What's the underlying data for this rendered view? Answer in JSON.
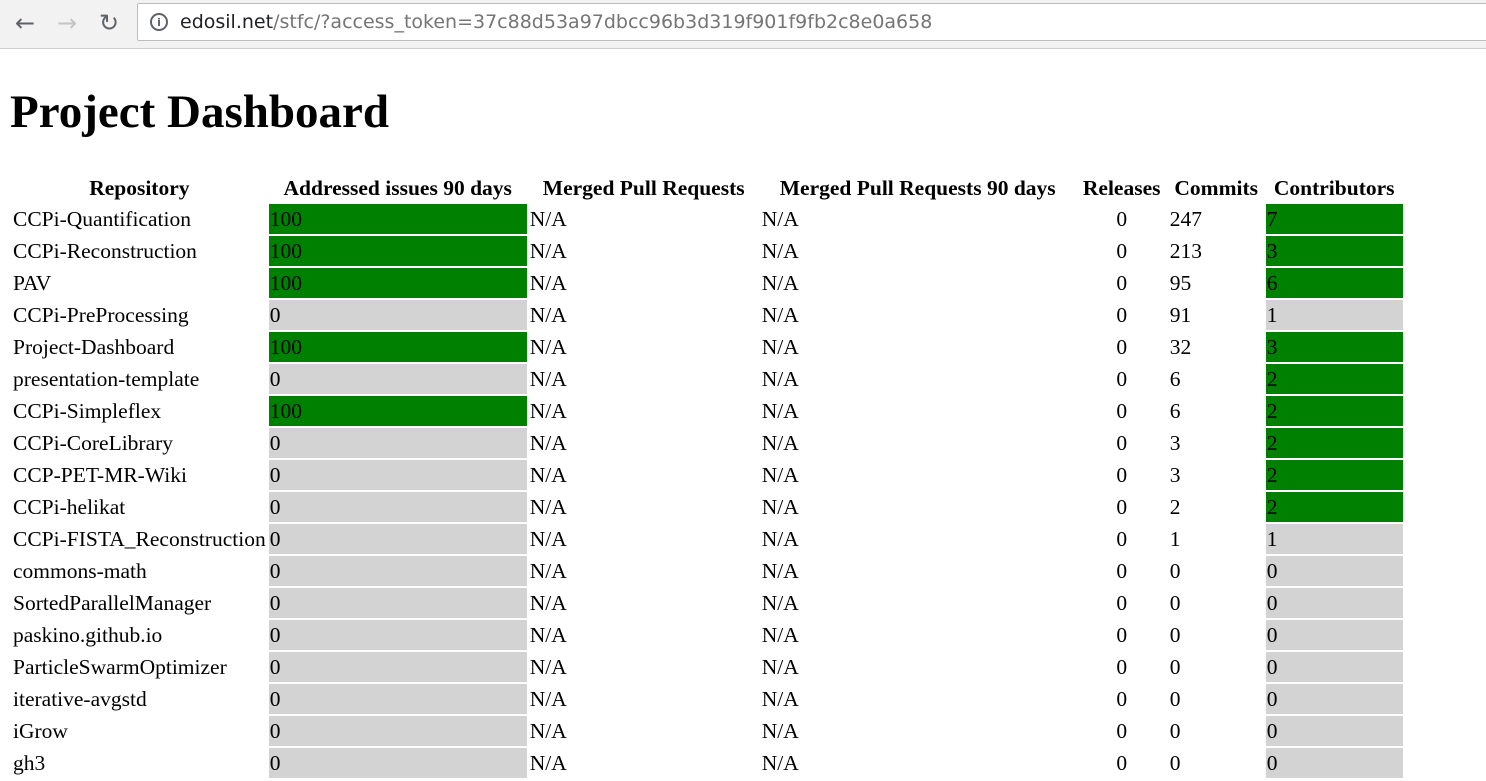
{
  "browser": {
    "url_host": "edosil.net",
    "url_path": "/stfc/?access_token=37c88d53a97dbcc96b3d319f901f9fb2c8e0a658"
  },
  "page_title": "Project Dashboard",
  "colors": {
    "good": "#008000",
    "none": "#d3d3d3"
  },
  "table": {
    "headers": [
      "Repository",
      "Addressed issues 90 days",
      "Merged Pull Requests",
      "Merged Pull Requests 90 days",
      "Releases",
      "Commits",
      "Contributors"
    ],
    "rows": [
      {
        "repo": "CCPi-Quantification",
        "issues": "100",
        "merged": "N/A",
        "merged90": "N/A",
        "releases": "0",
        "commits": "247",
        "contributors": "7"
      },
      {
        "repo": "CCPi-Reconstruction",
        "issues": "100",
        "merged": "N/A",
        "merged90": "N/A",
        "releases": "0",
        "commits": "213",
        "contributors": "3"
      },
      {
        "repo": "PAV",
        "issues": "100",
        "merged": "N/A",
        "merged90": "N/A",
        "releases": "0",
        "commits": "95",
        "contributors": "6"
      },
      {
        "repo": "CCPi-PreProcessing",
        "issues": "0",
        "merged": "N/A",
        "merged90": "N/A",
        "releases": "0",
        "commits": "91",
        "contributors": "1"
      },
      {
        "repo": "Project-Dashboard",
        "issues": "100",
        "merged": "N/A",
        "merged90": "N/A",
        "releases": "0",
        "commits": "32",
        "contributors": "3"
      },
      {
        "repo": "presentation-template",
        "issues": "0",
        "merged": "N/A",
        "merged90": "N/A",
        "releases": "0",
        "commits": "6",
        "contributors": "2"
      },
      {
        "repo": "CCPi-Simpleflex",
        "issues": "100",
        "merged": "N/A",
        "merged90": "N/A",
        "releases": "0",
        "commits": "6",
        "contributors": "2"
      },
      {
        "repo": "CCPi-CoreLibrary",
        "issues": "0",
        "merged": "N/A",
        "merged90": "N/A",
        "releases": "0",
        "commits": "3",
        "contributors": "2"
      },
      {
        "repo": "CCP-PET-MR-Wiki",
        "issues": "0",
        "merged": "N/A",
        "merged90": "N/A",
        "releases": "0",
        "commits": "3",
        "contributors": "2"
      },
      {
        "repo": "CCPi-helikat",
        "issues": "0",
        "merged": "N/A",
        "merged90": "N/A",
        "releases": "0",
        "commits": "2",
        "contributors": "2"
      },
      {
        "repo": "CCPi-FISTA_Reconstruction",
        "issues": "0",
        "merged": "N/A",
        "merged90": "N/A",
        "releases": "0",
        "commits": "1",
        "contributors": "1"
      },
      {
        "repo": "commons-math",
        "issues": "0",
        "merged": "N/A",
        "merged90": "N/A",
        "releases": "0",
        "commits": "0",
        "contributors": "0"
      },
      {
        "repo": "SortedParallelManager",
        "issues": "0",
        "merged": "N/A",
        "merged90": "N/A",
        "releases": "0",
        "commits": "0",
        "contributors": "0"
      },
      {
        "repo": "paskino.github.io",
        "issues": "0",
        "merged": "N/A",
        "merged90": "N/A",
        "releases": "0",
        "commits": "0",
        "contributors": "0"
      },
      {
        "repo": "ParticleSwarmOptimizer",
        "issues": "0",
        "merged": "N/A",
        "merged90": "N/A",
        "releases": "0",
        "commits": "0",
        "contributors": "0"
      },
      {
        "repo": "iterative-avgstd",
        "issues": "0",
        "merged": "N/A",
        "merged90": "N/A",
        "releases": "0",
        "commits": "0",
        "contributors": "0"
      },
      {
        "repo": "iGrow",
        "issues": "0",
        "merged": "N/A",
        "merged90": "N/A",
        "releases": "0",
        "commits": "0",
        "contributors": "0"
      },
      {
        "repo": "gh3",
        "issues": "0",
        "merged": "N/A",
        "merged90": "N/A",
        "releases": "0",
        "commits": "0",
        "contributors": "0"
      }
    ]
  }
}
